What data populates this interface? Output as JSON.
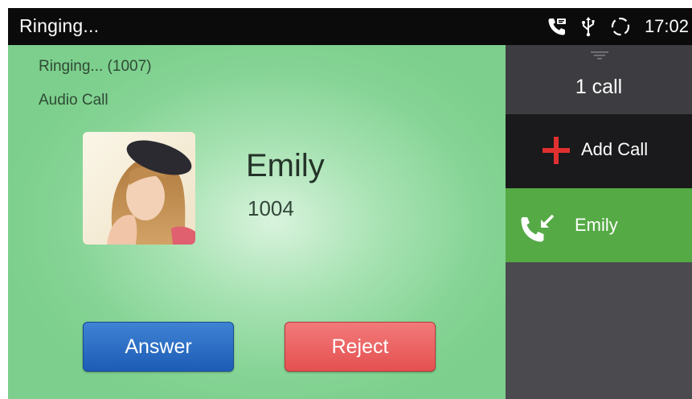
{
  "status_bar": {
    "title": "Ringing...",
    "time": "17:02",
    "icons": [
      "voicemail-phone-icon",
      "usb-icon",
      "sync-icon"
    ]
  },
  "call": {
    "status": "Ringing... (1007)",
    "type": "Audio Call",
    "contact_name": "Emily",
    "contact_number": "1004",
    "answer_label": "Answer",
    "reject_label": "Reject"
  },
  "side_panel": {
    "call_count": "1 call",
    "add_call_label": "Add Call",
    "calls": [
      {
        "name": "Emily",
        "icon": "incoming-call-icon"
      }
    ]
  },
  "colors": {
    "answer": "#2a6cc4",
    "reject": "#ea5c5c",
    "active_call": "#55aa45",
    "add_call_plus": "#e03030"
  }
}
